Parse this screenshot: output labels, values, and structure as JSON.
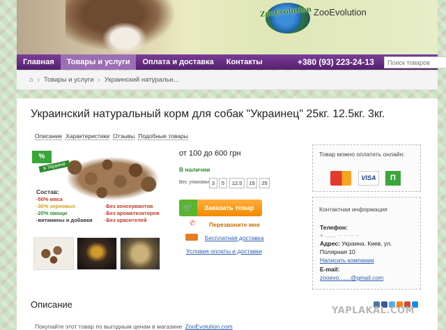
{
  "header": {
    "logo_mark": "ZooEvolution",
    "logo_text": "ZooEvolution"
  },
  "nav": {
    "items": [
      "Главная",
      "Товары и услуги",
      "Оплата и доставка",
      "Контакты"
    ],
    "active_index": 1,
    "phone": "+380 (93) 223-24-13",
    "search_placeholder": "Поиск товаров"
  },
  "breadcrumb": {
    "items": [
      "Товары и услуги",
      "Украинский натуральн..."
    ]
  },
  "product": {
    "title": "Украинский натуральный корм для собак \"Украинец\" 25кг. 12.5кг. 3кг.",
    "tabs": [
      "Описание",
      "Характеристики",
      "Отзывы",
      "Подобные товары"
    ],
    "image": {
      "badge": "%",
      "ribbon": "в Украине",
      "composition_title": "Состав:",
      "composition": [
        "-50% мяса",
        "-30% зерновых",
        "-20% овощи",
        "-витамины и добавки"
      ],
      "no_list": [
        "-Без консервантов",
        "-Без ароматизаторов",
        "-Без красителей"
      ]
    },
    "price": "от 100 до 600 грн",
    "stock": "В наличии",
    "weight_label": "Вес упаковки:",
    "weights": [
      "3",
      "5",
      "12.5",
      "15",
      "25"
    ],
    "order_button": "Заказать товар",
    "callback": "Перезвоните мне",
    "delivery": "Бесплатная доставка",
    "terms": "Условия оплаты и доставки"
  },
  "payment": {
    "title": "Товар можно оплатить онлайн:",
    "cards": [
      "MasterCard",
      "VISA",
      "PrivatBank"
    ]
  },
  "contacts": {
    "title": "Контактная информация",
    "phone_label": "Телефон:",
    "phone_value": "+ ....... ·· ·· ·· ··",
    "address_label": "Адрес:",
    "address_value_1": "Украина, Киев, ул.",
    "address_value_2": "Полярная 10",
    "write_link": "Написать компании",
    "email_label": "E-mail:",
    "email_value": "zooevo.......@gmail.com"
  },
  "description": {
    "title": "Описание",
    "text": "Покупайте этот товар по выгодным ценам в магазине",
    "link": "ZooEvolution.com"
  },
  "watermark": "YAPLAKAL.COM",
  "colors": {
    "nav_bg": "#55206e",
    "accent_order": "#f28a00",
    "stock_green": "#2e8a2e",
    "link_blue": "#2a5db0"
  }
}
